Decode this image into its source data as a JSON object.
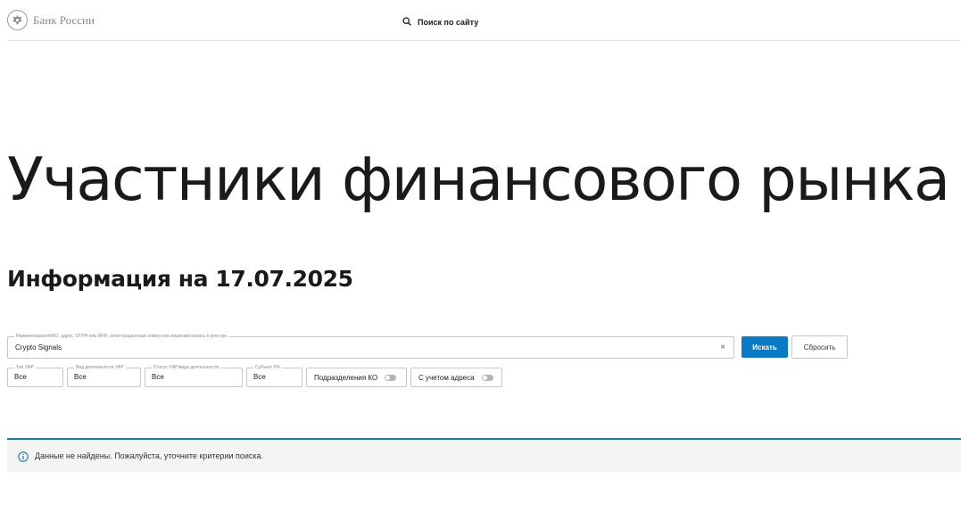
{
  "header": {
    "logo_text": "Банк России",
    "search_label": "Поиск по сайту"
  },
  "page": {
    "title": "Участники финансового рынка",
    "subtitle": "Информация на 17.07.2025"
  },
  "search": {
    "legend": "Наименование/ФИО, адрес, ОГРН или ИНН, регистрационный номер или лицензия/запись в реестре",
    "value": "Crypto Signals",
    "clear_symbol": "×",
    "submit_label": "Искать",
    "reset_label": "Сбросить"
  },
  "filters": [
    {
      "legend": "Тип УФР",
      "value": "Все"
    },
    {
      "legend": "Вид деятельности УФР",
      "value": "Все"
    },
    {
      "legend": "Статус УФР/вида деятельности",
      "value": "Все"
    },
    {
      "legend": "Субъект РФ",
      "value": "Все"
    }
  ],
  "toggles": [
    {
      "label": "Подразделения КО",
      "on": false
    },
    {
      "label": "С учетом адреса",
      "on": false
    }
  ],
  "notice": {
    "icon": "info-icon",
    "text": "Данные не найдены. Пожалуйста, уточните критерии поиска."
  },
  "colors": {
    "primary": "#0a7ac4",
    "notice_border": "#1b7d98",
    "notice_bg": "#f4f4f4"
  }
}
